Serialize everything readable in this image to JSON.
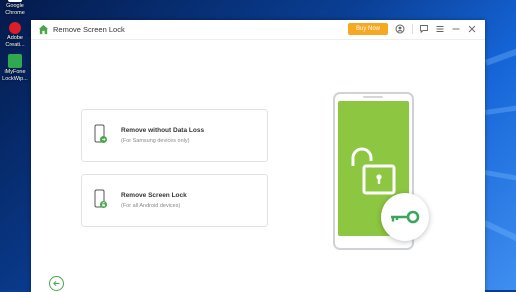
{
  "desktop": {
    "icons": [
      {
        "name": "google-chrome",
        "label": "Google Chrome",
        "color": "#ffffff"
      },
      {
        "name": "adobe-creative",
        "label": "Adobe Creati...",
        "color": "#da1f26"
      },
      {
        "name": "imyfone-lockwiper",
        "label": "iMyFone LockWip...",
        "color": "#2fa84f"
      }
    ]
  },
  "window": {
    "title": "Remove Screen Lock",
    "buy_label": "Buy Now",
    "accent": "#48a849",
    "buy_color": "#f7a823"
  },
  "options": [
    {
      "title": "Remove without Data Loss",
      "subtitle": "(For Samsung devices only)"
    },
    {
      "title": "Remove Screen Lock",
      "subtitle": "(For all Android devices)"
    }
  ],
  "illustration": {
    "screen_color": "#8dc640"
  }
}
